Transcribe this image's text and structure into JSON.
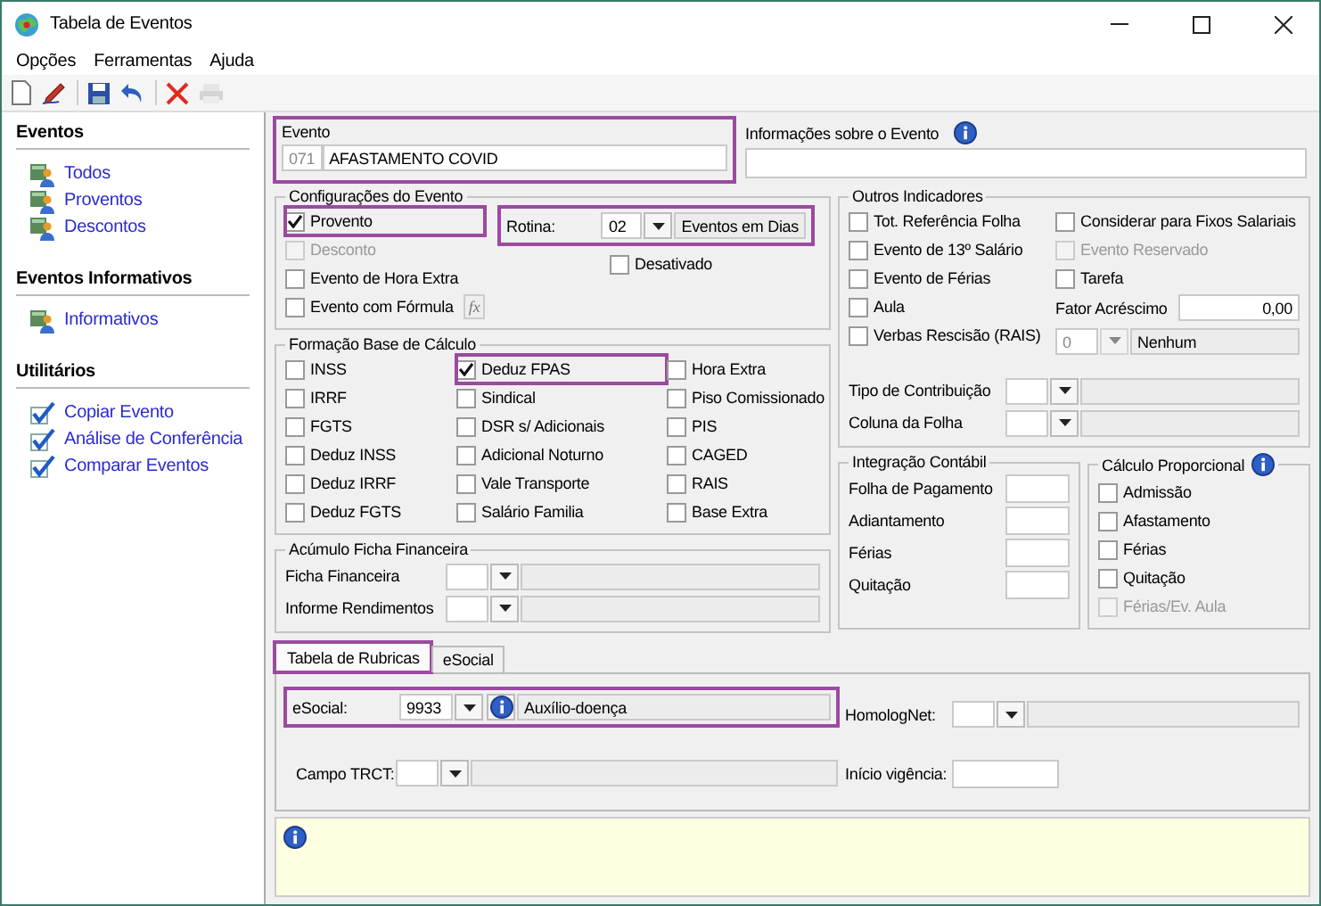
{
  "window": {
    "title": "Tabela de Eventos"
  },
  "menu": [
    {
      "label": "Opções"
    },
    {
      "label": "Ferramentas"
    },
    {
      "label": "Ajuda"
    }
  ],
  "toolbar": [
    {
      "kind": "new",
      "disabled": false
    },
    {
      "kind": "edit",
      "disabled": false
    },
    {
      "kind": "separator"
    },
    {
      "kind": "save",
      "disabled": false
    },
    {
      "kind": "undo",
      "disabled": false
    },
    {
      "kind": "separator"
    },
    {
      "kind": "delete",
      "disabled": false
    },
    {
      "kind": "print",
      "disabled": true
    }
  ],
  "sidebar": {
    "sections": [
      {
        "title": "Eventos",
        "items": [
          {
            "label": "Todos",
            "kind": "people"
          },
          {
            "label": "Proventos",
            "kind": "people"
          },
          {
            "label": "Descontos",
            "kind": "people"
          }
        ]
      },
      {
        "title": "Eventos Informativos",
        "items": [
          {
            "label": "Informativos",
            "kind": "people"
          }
        ]
      },
      {
        "title": "Utilitários",
        "items": [
          {
            "label": "Copiar Evento",
            "kind": "check"
          },
          {
            "label": "Análise de Conferência",
            "kind": "check"
          },
          {
            "label": "Comparar Eventos",
            "kind": "check"
          }
        ]
      }
    ]
  },
  "evento": {
    "label": "Evento",
    "code": "071",
    "name": "AFASTAMENTO COVID",
    "highlighted": true
  },
  "info": {
    "label": "Informações sobre o Evento"
  },
  "config": {
    "title": "Configurações do Evento",
    "checkboxes": [
      {
        "label": "Provento",
        "checked": true,
        "disabled": false,
        "highlighted": true
      },
      {
        "label": "Desconto",
        "checked": false,
        "disabled": true,
        "highlighted": false
      },
      {
        "label": "Evento de Hora Extra",
        "checked": false,
        "disabled": false,
        "highlighted": false
      },
      {
        "label": "Evento com Fórmula",
        "checked": false,
        "disabled": false,
        "highlighted": false
      }
    ],
    "formula_button": "fx",
    "rotina": {
      "label": "Rotina:",
      "code": "02",
      "description": "Eventos em Dias",
      "highlighted": true
    },
    "desativado": {
      "label": "Desativado",
      "checked": false
    }
  },
  "base": {
    "title": "Formação Base de Cálculo",
    "checkboxes": [
      {
        "label": "INSS",
        "checked": false,
        "highlighted": false
      },
      {
        "label": "IRRF",
        "checked": false,
        "highlighted": false
      },
      {
        "label": "FGTS",
        "checked": false,
        "highlighted": false
      },
      {
        "label": "Deduz INSS",
        "checked": false,
        "highlighted": false
      },
      {
        "label": "Deduz IRRF",
        "checked": false,
        "highlighted": false
      },
      {
        "label": "Deduz FGTS",
        "checked": false,
        "highlighted": false
      },
      {
        "label": "Deduz FPAS",
        "checked": true,
        "highlighted": true
      },
      {
        "label": "Sindical",
        "checked": false,
        "highlighted": false
      },
      {
        "label": "DSR s/ Adicionais",
        "checked": false,
        "highlighted": false
      },
      {
        "label": "Adicional Noturno",
        "checked": false,
        "highlighted": false
      },
      {
        "label": "Vale Transporte",
        "checked": false,
        "highlighted": false
      },
      {
        "label": "Salário Familia",
        "checked": false,
        "highlighted": false
      },
      {
        "label": "Hora Extra",
        "checked": false,
        "highlighted": false
      },
      {
        "label": "Piso Comissionado",
        "checked": false,
        "highlighted": false
      },
      {
        "label": "PIS",
        "checked": false,
        "highlighted": false
      },
      {
        "label": "CAGED",
        "checked": false,
        "highlighted": false
      },
      {
        "label": "RAIS",
        "checked": false,
        "highlighted": false
      },
      {
        "label": "Base Extra",
        "checked": false,
        "highlighted": false
      }
    ]
  },
  "acumulo": {
    "title": "Acúmulo Ficha Financeira",
    "rows": [
      {
        "label": "Ficha Financeira"
      },
      {
        "label": "Informe Rendimentos"
      }
    ]
  },
  "outros": {
    "title": "Outros Indicadores",
    "left": [
      {
        "label": "Tot. Referência Folha",
        "checked": false,
        "disabled": false
      },
      {
        "label": "Evento de 13º Salário",
        "checked": false,
        "disabled": false
      },
      {
        "label": "Evento de Férias",
        "checked": false,
        "disabled": false
      },
      {
        "label": "Aula",
        "checked": false,
        "disabled": false
      },
      {
        "label": "Verbas Rescisão (RAIS)",
        "checked": false,
        "disabled": false
      }
    ],
    "right": [
      {
        "label": "Considerar para Fixos Salariais",
        "checked": false,
        "disabled": false
      },
      {
        "label": "Evento Reservado",
        "checked": false,
        "disabled": true
      },
      {
        "label": "Tarefa",
        "checked": false,
        "disabled": false
      }
    ],
    "fator": {
      "label": "Fator Acréscimo",
      "value": "0,00"
    },
    "nenhum": {
      "code": "0",
      "description": "Nenhum",
      "disabled": true
    },
    "combos": [
      {
        "label": "Tipo de Contribuição"
      },
      {
        "label": "Coluna da Folha"
      }
    ]
  },
  "integracao": {
    "title": "Integração Contábil",
    "fields": [
      {
        "label": "Folha de Pagamento"
      },
      {
        "label": "Adiantamento"
      },
      {
        "label": "Férias"
      },
      {
        "label": "Quitação"
      }
    ]
  },
  "proporcional": {
    "title": "Cálculo Proporcional",
    "checkboxes": [
      {
        "label": "Admissão",
        "checked": false,
        "disabled": false
      },
      {
        "label": "Afastamento",
        "checked": false,
        "disabled": false
      },
      {
        "label": "Férias",
        "checked": false,
        "disabled": false
      },
      {
        "label": "Quitação",
        "checked": false,
        "disabled": false
      },
      {
        "label": "Férias/Ev. Aula",
        "checked": false,
        "disabled": true
      }
    ]
  },
  "tabs": [
    {
      "label": "Tabela de Rubricas",
      "selected": true,
      "highlighted": true
    },
    {
      "label": "eSocial",
      "selected": false,
      "highlighted": false
    }
  ],
  "rubricas": {
    "esocial": {
      "label": "eSocial:",
      "code": "9933",
      "description": "Auxílio-doença",
      "highlighted": true
    },
    "trct": {
      "label": "Campo TRCT:"
    },
    "homolognet": {
      "label": "HomologNet:"
    },
    "inicio": {
      "label": "Início vigência:"
    }
  }
}
